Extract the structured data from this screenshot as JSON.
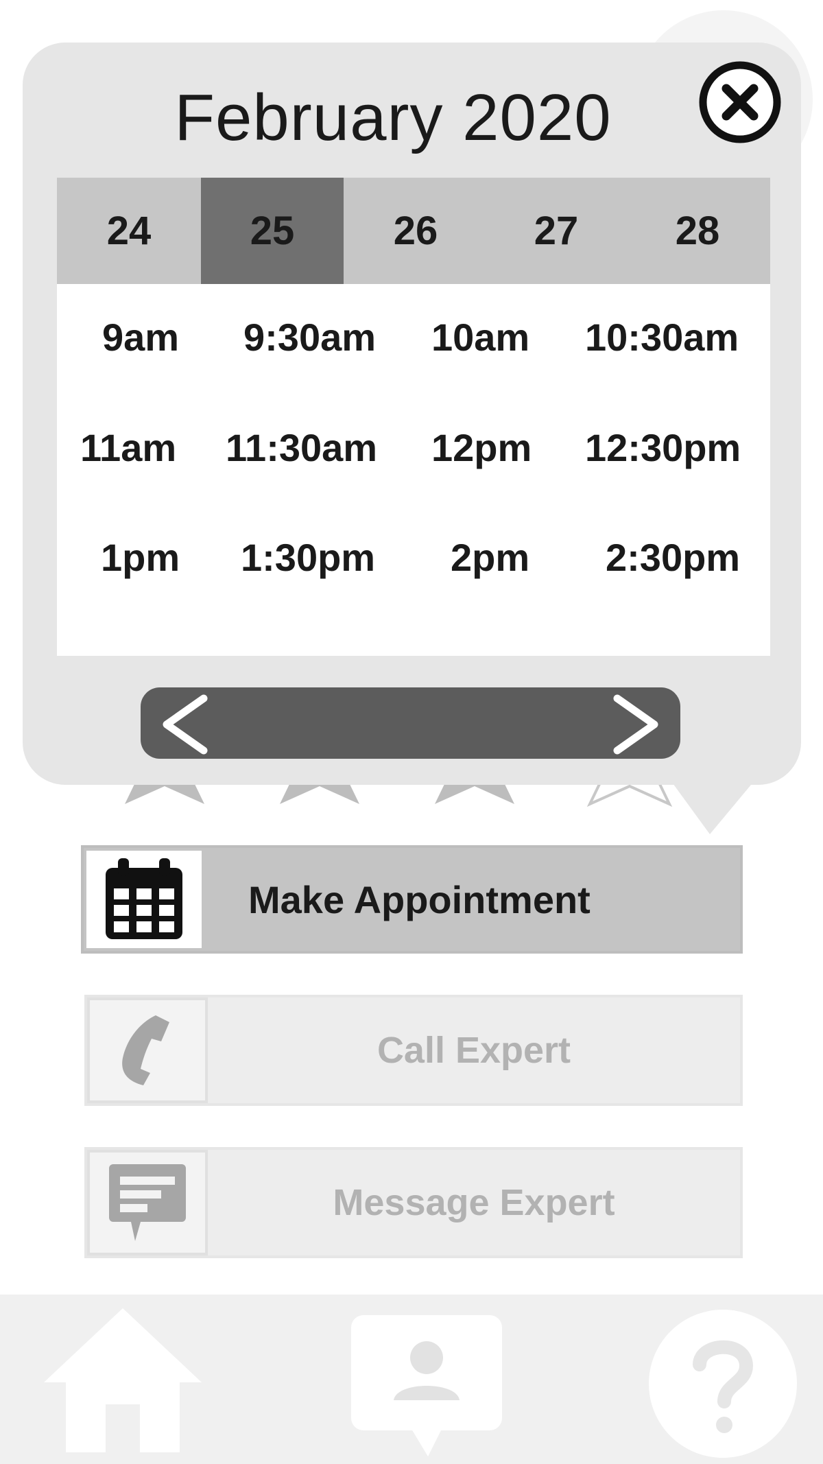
{
  "calendar": {
    "month_title": "February 2020",
    "days": [
      {
        "label": "24",
        "selected": false
      },
      {
        "label": "25",
        "selected": true
      },
      {
        "label": "26",
        "selected": false
      },
      {
        "label": "27",
        "selected": false
      },
      {
        "label": "28",
        "selected": false
      }
    ],
    "time_slots": [
      [
        "9am",
        "9:30am",
        "10am",
        "10:30am"
      ],
      [
        "11am",
        "11:30am",
        "12pm",
        "12:30pm"
      ],
      [
        "1pm",
        "1:30pm",
        "2pm",
        "2:30pm"
      ]
    ],
    "icons": {
      "close": "close-circle-icon",
      "prev": "chevron-left-icon",
      "next": "chevron-right-icon"
    },
    "colors": {
      "popup_bg": "#e6e6e6",
      "day_strip": "#c6c6c6",
      "day_selected": "#707070",
      "pager": "#5c5c5c"
    }
  },
  "rating": {
    "stars_visible": 4,
    "filled": 3
  },
  "actions": {
    "make_appointment": {
      "label": "Make Appointment",
      "icon": "calendar-icon"
    },
    "call_expert": {
      "label": "Call Expert",
      "icon": "phone-icon"
    },
    "message_expert": {
      "label": "Message Expert",
      "icon": "message-icon"
    }
  },
  "bottom_nav": {
    "items": [
      {
        "icon": "home-icon"
      },
      {
        "icon": "contact-chat-icon"
      },
      {
        "icon": "help-icon"
      }
    ]
  }
}
